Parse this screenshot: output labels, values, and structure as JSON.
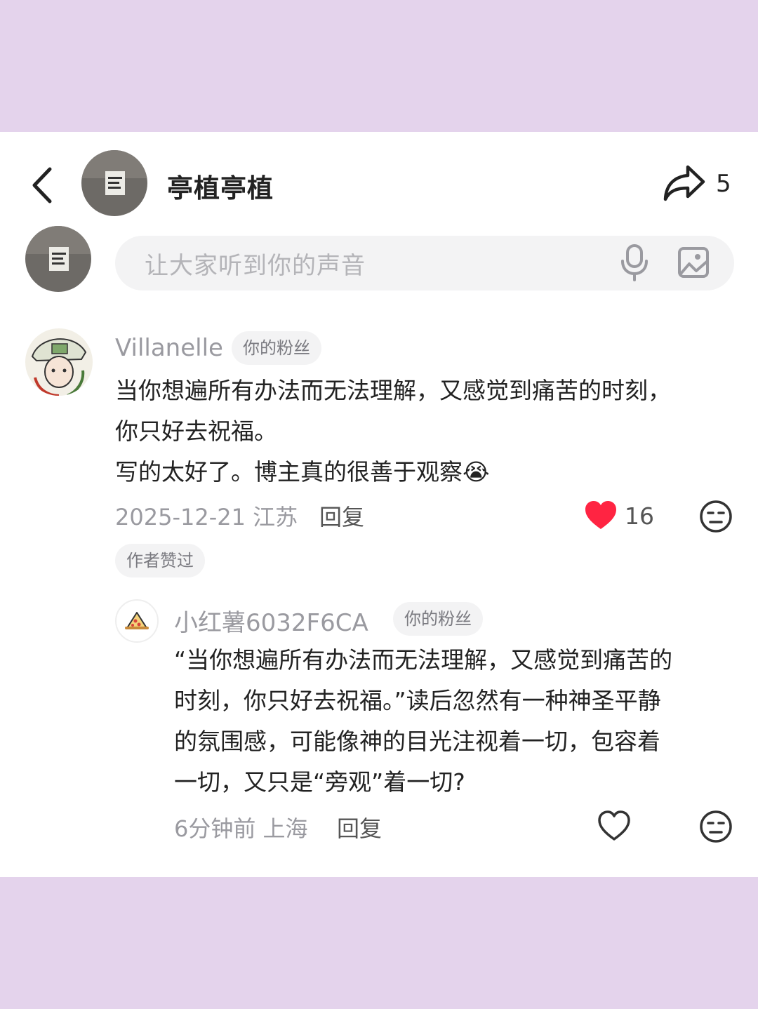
{
  "header": {
    "title": "亭植亭植",
    "share_count": "5"
  },
  "input": {
    "placeholder": "让大家听到你的声音"
  },
  "comments": [
    {
      "user": "Villanelle",
      "badge": "你的粉丝",
      "lines": [
        "当你想遍所有办法而无法理解，又感觉到痛苦的时刻，",
        "你只好去祝福。",
        "写的太好了。博主真的很善于观察😭"
      ],
      "date_location": "2025-12-21 江苏",
      "reply_label": "回复",
      "likes": "16",
      "liked": true,
      "author_liked_label": "作者赞过"
    },
    {
      "user": "小红薯6032F6CA",
      "badge": "你的粉丝",
      "lines": [
        "“当你想遍所有办法而无法理解，又感觉到痛苦的",
        "时刻，你只好去祝福。”读后忽然有一种神圣平静",
        "的氛围感，可能像神的目光注视着一切，包容着",
        "一切，又只是“旁观”着一切?"
      ],
      "date_location": "6分钟前 上海",
      "reply_label": "回复",
      "liked": false
    }
  ],
  "colors": {
    "background_band": "#e4d3ec",
    "heart_red": "#ff2442",
    "muted_text": "#9a9aa0"
  },
  "icons": [
    "back-arrow-icon",
    "share-icon",
    "microphone-icon",
    "image-icon",
    "heart-icon",
    "neutral-face-icon",
    "pizza-avatar-icon"
  ]
}
